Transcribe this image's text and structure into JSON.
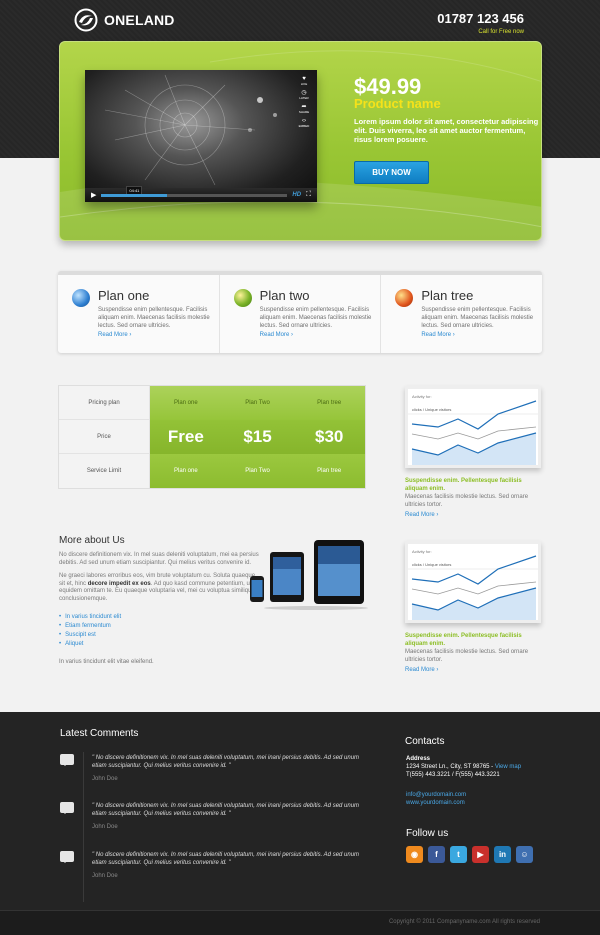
{
  "header": {
    "logo_text": "ONELAND",
    "phone": "01787 123 456",
    "phone_sub": "Call for Free now"
  },
  "hero": {
    "price": "$49.99",
    "product_name": "Product name",
    "description": "Lorem ipsum dolor sit amet, consectetur adipiscing elit. Duis viverra, leo sit amet auctor fermentum, risus lorem posuere.",
    "buy_label": "BUY NOW",
    "video": {
      "time": "04:41",
      "progress": 0.35,
      "hd_label": "HD",
      "side_icons": [
        {
          "name": "like-icon",
          "label": "LIKE"
        },
        {
          "name": "later-icon",
          "label": "LATER"
        },
        {
          "name": "share-icon",
          "label": "SHARE"
        },
        {
          "name": "embed-icon",
          "label": "EMBED"
        }
      ]
    }
  },
  "plans": [
    {
      "title": "Plan one",
      "text": "Suspendisse enim pellentesque. Facilisis aliquam enim. Maecenas facilisis molestie lectus. Sed ornare ultricies.",
      "link": "Read More ›",
      "color": "#2e7fd1"
    },
    {
      "title": "Plan two",
      "text": "Suspendisse enim pellentesque. Facilisis aliquam enim. Maecenas facilisis molestie lectus. Sed ornare ultricies.",
      "link": "Read More ›",
      "color": "#7bb328"
    },
    {
      "title": "Plan tree",
      "text": "Suspendisse enim pellentesque. Facilisis aliquam enim. Maecenas facilisis molestie lectus. Sed ornare ultricies.",
      "link": "Read More ›",
      "color": "#e0541c"
    }
  ],
  "pricing": {
    "labels": [
      "Pricing plan",
      "Price",
      "Service Limit"
    ],
    "head": [
      "Plan one",
      "Plan Two",
      "Plan tree"
    ],
    "prices": [
      "Free",
      "$15",
      "$30"
    ],
    "limits": [
      "Plan one",
      "Plan Two",
      "Plan tree"
    ]
  },
  "widgets": [
    {
      "chart_label": "Activity for:",
      "chart_sub": "clicks / Unique visitors",
      "head": "Suspendisse enim. Pellentesque facilisis aliquam enim.",
      "text": "Maecenas facilisis molestie lectus. Sed ornare ultricies tortor.",
      "link": "Read More ›"
    },
    {
      "chart_label": "Activity for:",
      "chart_sub": "clicks / Unique visitors",
      "head": "Suspendisse enim. Pellentesque facilisis aliquam enim.",
      "text": "Maecenas facilisis molestie lectus. Sed ornare ultricies tortor.",
      "link": "Read More ›"
    }
  ],
  "about": {
    "title": "More about Us",
    "p1": "No discere definitionem vix. In mel suas deleniti voluptatum, mei ea persius debitis. Ad sed unum etiam suscipiantur. Qui melius veritus convenire id.",
    "p2_before": "Ne graeci labores erroribus eos, vim brute voluptatum cu. Soluta quaeque sit et, hinc ",
    "p2_bold": "decore impedit ex eos",
    "p2_after": ". Ad quo kasd commune petentium, usu equidem omittam te. Eu quaeque voluptaria vel, mei cu voluptua similique conclusionemque.",
    "list": [
      "In varius tincidunt elit",
      "Etiam fermentum",
      "Suscipit est",
      "Aliquet"
    ],
    "foot": "In varius tincidunt elit vitae eleifend."
  },
  "footer": {
    "comments_title": "Latest Comments",
    "comments": [
      {
        "text": "\" No discere definitionem vix. In mel suas deleniti voluptatum, mei inani persius debitis. Ad sed unum etiam suscipiantur. Qui melius veritus convenire id. \"",
        "author": "John Doe"
      },
      {
        "text": "\" No discere definitionem vix. In mel suas deleniti voluptatum, mei inani persius debitis. Ad sed unum etiam suscipiantur. Qui melius veritus convenire id. \"",
        "author": "John Doe"
      },
      {
        "text": "\" No discere definitionem vix. In mel suas deleniti voluptatum, mei inani persius debitis. Ad sed unum etiam suscipiantur. Qui melius veritus convenire id. \"",
        "author": "John Doe"
      }
    ],
    "contacts_title": "Contacts",
    "address_label": "Address",
    "address_line": "1234 Street Ln., City, ST 98765 - ",
    "view_map": "View map",
    "phone_line": "T(555) 443.3221 / F(555) 443.3221",
    "email": "info@yourdomain.com",
    "website": "www.yourdomain.com",
    "follow_title": "Follow us",
    "social": [
      {
        "name": "rss-icon",
        "glyph": "◉",
        "color": "#ef8a1e"
      },
      {
        "name": "facebook-icon",
        "glyph": "f",
        "color": "#3b5998"
      },
      {
        "name": "twitter-icon",
        "glyph": "t",
        "color": "#3aa8e0"
      },
      {
        "name": "youtube-icon",
        "glyph": "▶",
        "color": "#c9302c"
      },
      {
        "name": "linkedin-icon",
        "glyph": "in",
        "color": "#1f78b4"
      },
      {
        "name": "myspace-icon",
        "glyph": "☺",
        "color": "#3f6fb0"
      }
    ],
    "copyright": "Copyright © 2011 Companyname.com All rights reserved"
  }
}
